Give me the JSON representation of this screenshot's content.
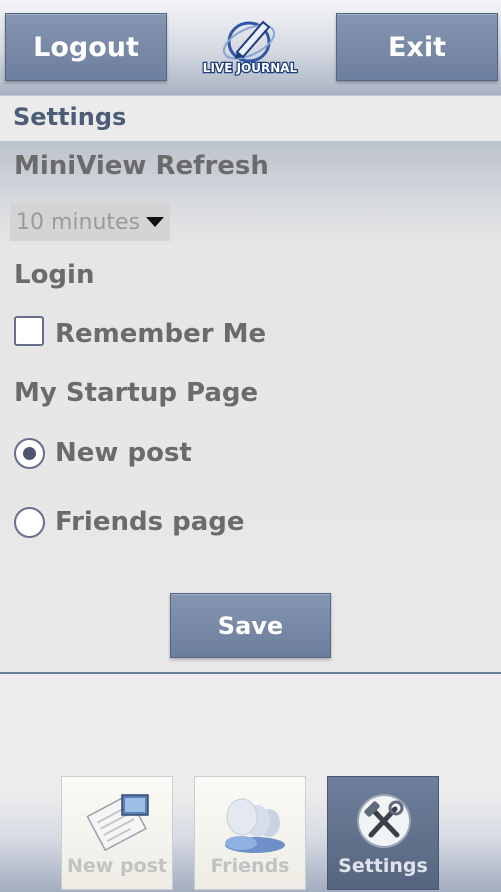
{
  "header": {
    "logout_label": "Logout",
    "exit_label": "Exit",
    "logo_text": "LIVE JOURNAL"
  },
  "page": {
    "title": "Settings"
  },
  "settings": {
    "miniview_label": "MiniView Refresh",
    "refresh_value": "10 minutes",
    "login_label": "Login",
    "remember_me_label": "Remember Me",
    "remember_me_checked": false,
    "startup_label": "My Startup Page",
    "startup_options": [
      {
        "label": "New post",
        "selected": true
      },
      {
        "label": "Friends page",
        "selected": false
      }
    ],
    "save_label": "Save"
  },
  "tabs": [
    {
      "label": "New post",
      "icon": "new-post-icon",
      "active": false
    },
    {
      "label": "Friends",
      "icon": "friends-icon",
      "active": false
    },
    {
      "label": "Settings",
      "icon": "settings-icon",
      "active": true
    }
  ],
  "colors": {
    "accent": "#7587a5",
    "subtitle_text": "#4d5d79",
    "divider": "#6a7fa0"
  }
}
